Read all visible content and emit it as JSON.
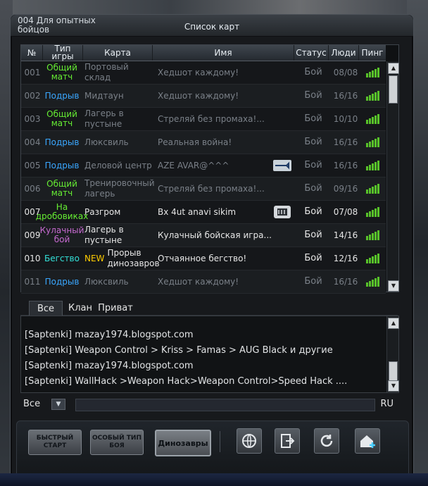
{
  "window": {
    "room_name": "004 Для опытных бойцов",
    "title": "Список карт"
  },
  "table": {
    "headers": {
      "num": "№",
      "type": "Тип игры",
      "map": "Карта",
      "name": "Имя",
      "status": "Статус",
      "players": "Люди",
      "ping": "Пинг"
    },
    "rows": [
      {
        "num": "001",
        "type": "Общий матч",
        "type_color": "#66ee33",
        "map": "Портовый склад",
        "name": "Хедшот каждому!",
        "status": "Бой",
        "players": "08/08",
        "ping": 5,
        "active": false
      },
      {
        "num": "002",
        "type": "Подрыв",
        "type_color": "#3aa7ff",
        "map": "Мидтаун",
        "name": "Хедшот каждому!",
        "status": "Бой",
        "players": "16/16",
        "ping": 5,
        "active": false
      },
      {
        "num": "003",
        "type": "Общий матч",
        "type_color": "#66ee33",
        "map": "Лагерь в пустыне",
        "name": "Стреляй без промаха!...",
        "status": "Бой",
        "players": "10/10",
        "ping": 5,
        "active": false
      },
      {
        "num": "004",
        "type": "Подрыв",
        "type_color": "#3aa7ff",
        "map": "Люксвиль",
        "name": "Реальная война!",
        "status": "Бой",
        "players": "16/16",
        "ping": 5,
        "active": false
      },
      {
        "num": "005",
        "type": "Подрыв",
        "type_color": "#3aa7ff",
        "map": "Деловой центр",
        "name": "AZE AVAR@^^^",
        "status": "Бой",
        "players": "16/16",
        "ping": 5,
        "active": false,
        "icon": "weapon-icon"
      },
      {
        "num": "006",
        "type": "Общий матч",
        "type_color": "#66ee33",
        "map": "Тренировочный лагерь",
        "name": "Стреляй без промаха!...",
        "status": "Бой",
        "players": "09/16",
        "ping": 5,
        "active": false
      },
      {
        "num": "007",
        "type": "На дробовиках",
        "type_color": "#66ee33",
        "map": "Разгром",
        "name": "Bx 4ut anavi sikim",
        "status": "Бой",
        "players": "07/08",
        "ping": 5,
        "active": true,
        "icon": "magazine-icon"
      },
      {
        "num": "009",
        "type": "Кулачный бой",
        "type_color": "#c66ad0",
        "map": "Лагерь в пустыне",
        "name": "Кулачный бойская игра...",
        "status": "Бой",
        "players": "14/16",
        "ping": 5,
        "active": true
      },
      {
        "num": "010",
        "type": "Бегство",
        "type_color": "#33e0d8",
        "map": "Прорыв динозавров",
        "map_tag": "NEW",
        "name": "Отчаянное бегство!",
        "status": "Бой",
        "players": "12/16",
        "ping": 5,
        "active": true
      },
      {
        "num": "011",
        "type": "Подрыв",
        "type_color": "#3aa7ff",
        "map": "Люксвиль",
        "name": "Хедшот каждому!",
        "status": "Бой",
        "players": "16/16",
        "ping": 5,
        "active": false
      }
    ]
  },
  "chat": {
    "tabs": [
      "Все",
      "Клан",
      "Приват"
    ],
    "lines": [
      "[Saptenki] mazay1974.blogspot.com",
      "[Saptenki] Weapon Control > Kriss > Famas > AUG Black и  другие",
      "[Saptenki] mazay1974.blogspot.com",
      "[Saptenki] WallHack >Weapon Hack>Weapon Control>Speed Hack ...."
    ],
    "channel": "Все",
    "language": "RU",
    "input_value": ""
  },
  "bottom": {
    "quick_start": "БЫСТРЫЙ СТАРТ",
    "special_type": "ОСОБЫЙ ТИП БОЯ",
    "dinosaurs": "Динозавры",
    "icons": [
      "globe-icon",
      "exit-door-icon",
      "refresh-icon",
      "home-add-icon"
    ]
  },
  "colors": {
    "accent_green": "#66ee33",
    "accent_blue": "#3aa7ff",
    "ping_green": "#58c22a"
  }
}
